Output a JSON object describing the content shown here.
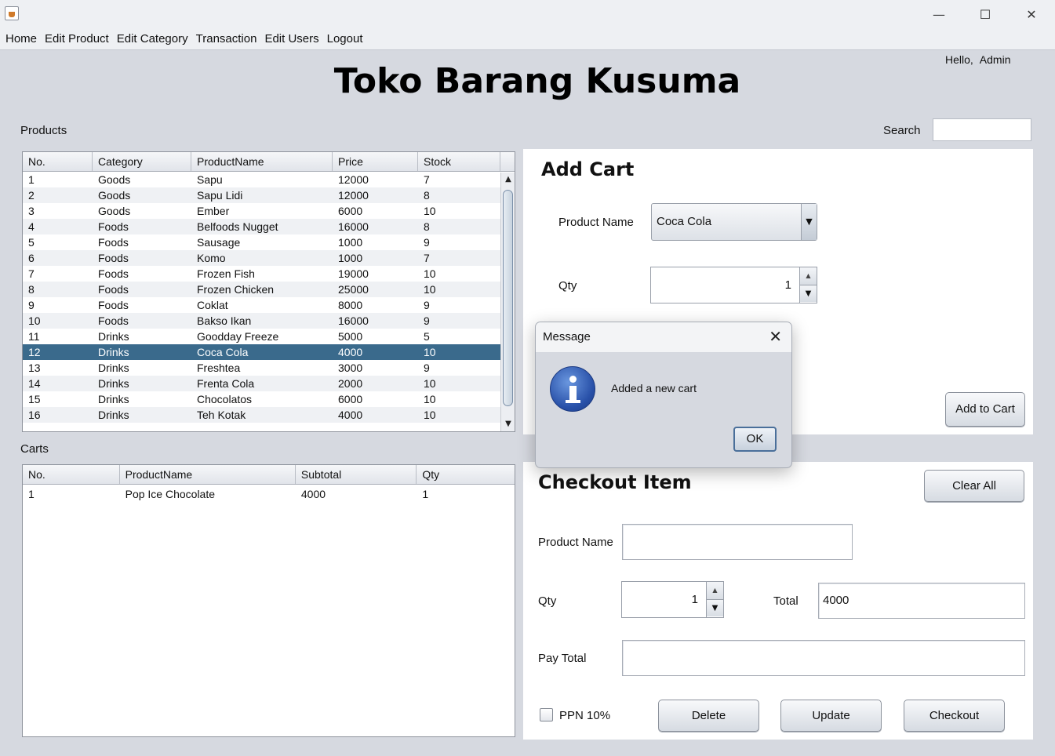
{
  "menu": [
    "Home",
    "Edit Product",
    "Edit Category",
    "Transaction",
    "Edit Users",
    "Logout"
  ],
  "window_controls": {
    "minimize": "—",
    "maximize": "☐",
    "close": "✕"
  },
  "greeting": {
    "hello": "Hello,",
    "user": "Admin"
  },
  "app_title": "Toko Barang Kusuma",
  "products": {
    "label": "Products",
    "columns": [
      "No.",
      "Category",
      "ProductName",
      "Price",
      "Stock"
    ],
    "rows": [
      [
        "1",
        "Goods",
        "Sapu",
        "12000",
        "7"
      ],
      [
        "2",
        "Goods",
        "Sapu Lidi",
        "12000",
        "8"
      ],
      [
        "3",
        "Goods",
        "Ember",
        "6000",
        "10"
      ],
      [
        "4",
        "Foods",
        "Belfoods Nugget",
        "16000",
        "8"
      ],
      [
        "5",
        "Foods",
        "Sausage",
        "1000",
        "9"
      ],
      [
        "6",
        "Foods",
        "Komo",
        "1000",
        "7"
      ],
      [
        "7",
        "Foods",
        "Frozen Fish",
        "19000",
        "10"
      ],
      [
        "8",
        "Foods",
        "Frozen Chicken",
        "25000",
        "10"
      ],
      [
        "9",
        "Foods",
        "Coklat",
        "8000",
        "9"
      ],
      [
        "10",
        "Foods",
        "Bakso Ikan",
        "16000",
        "9"
      ],
      [
        "11",
        "Drinks",
        "Goodday Freeze",
        "5000",
        "5"
      ],
      [
        "12",
        "Drinks",
        "Coca Cola",
        "4000",
        "10"
      ],
      [
        "13",
        "Drinks",
        "Freshtea",
        "3000",
        "9"
      ],
      [
        "14",
        "Drinks",
        "Frenta Cola",
        "2000",
        "10"
      ],
      [
        "15",
        "Drinks",
        "Chocolatos",
        "6000",
        "10"
      ],
      [
        "16",
        "Drinks",
        "Teh Kotak",
        "4000",
        "10"
      ]
    ],
    "selected_row": "12"
  },
  "search": {
    "label": "Search",
    "value": ""
  },
  "carts": {
    "label": "Carts",
    "columns": [
      "No.",
      "ProductName",
      "Subtotal",
      "Qty"
    ],
    "rows": [
      [
        "1",
        "Pop Ice Chocolate",
        "4000",
        "1"
      ]
    ]
  },
  "add_cart": {
    "heading": "Add Cart",
    "product_name_label": "Product Name",
    "product_name_value": "Coca Cola",
    "qty_label": "Qty",
    "qty_value": "1",
    "add_button": "Add to Cart"
  },
  "checkout": {
    "heading": "Checkout Item",
    "clear_button": "Clear All",
    "product_name_label": "Product Name",
    "product_name_value": "",
    "qty_label": "Qty",
    "qty_value": "1",
    "total_label": "Total",
    "total_value": "4000",
    "pay_total_label": "Pay Total",
    "pay_total_value": "",
    "ppn_label": "PPN 10%",
    "ppn_checked": false,
    "delete_button": "Delete",
    "update_button": "Update",
    "checkout_button": "Checkout"
  },
  "dialog": {
    "title": "Message",
    "message": "Added a new cart",
    "ok_button": "OK",
    "close_glyph": "✕",
    "icon": "info-icon"
  }
}
